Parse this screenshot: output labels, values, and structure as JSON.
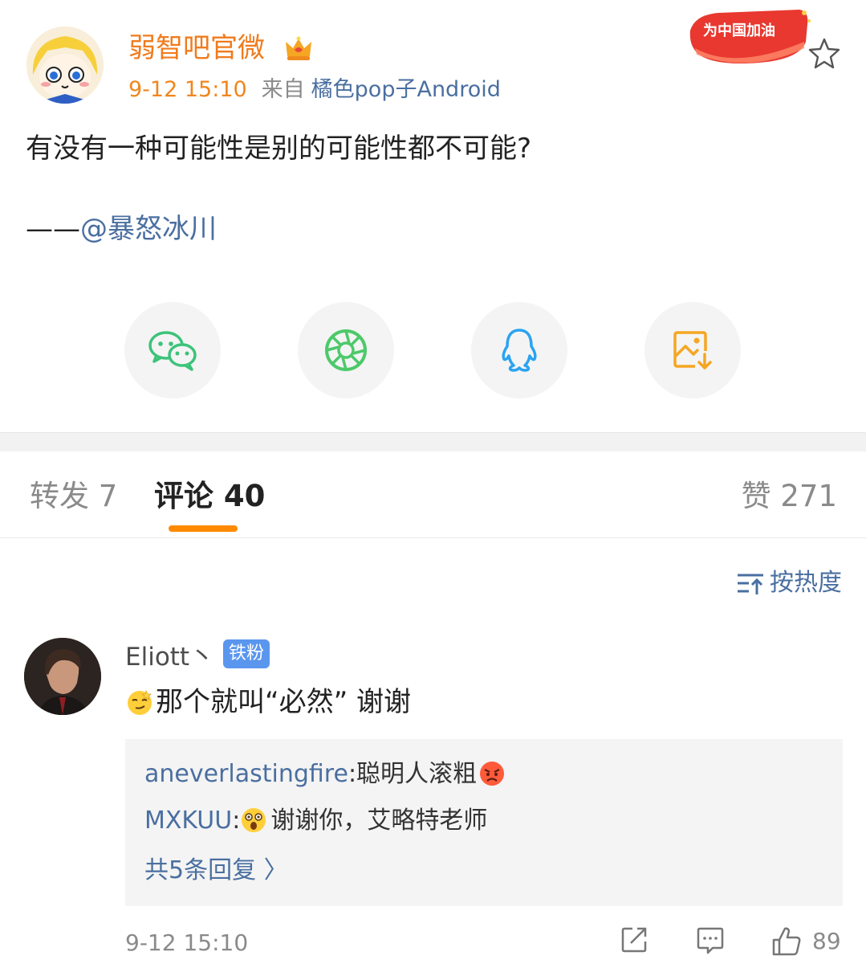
{
  "post": {
    "author": "弱智吧官微",
    "time": "9-12 15:10",
    "from_label": "来自",
    "source": "橘色pop子Android",
    "badge_text": "为中国加油",
    "body": "有没有一种可能性是别的可能性都不可能?",
    "sign_dash": "——",
    "sign_mention": "@暴怒冰川"
  },
  "share": {
    "items": [
      "wechat-icon",
      "moments-icon",
      "qq-icon",
      "save-image-icon"
    ],
    "colors": {
      "wechat": "#3cc37a",
      "moments": "#4dc96a",
      "qq": "#2aa3f2",
      "save": "#f5a623"
    }
  },
  "tabs": {
    "repost": "转发 7",
    "comment": "评论 40",
    "like": "赞 271"
  },
  "sort_label": "按热度",
  "comment": {
    "user": "Eliott丶",
    "badge": "铁粉",
    "text": "那个就叫“必然” 谢谢",
    "replies": [
      {
        "user": "aneverlastingfire",
        "sep": ": ",
        "text": "聪明人滚粗"
      },
      {
        "user": "MXKUU",
        "sep": ": ",
        "text": "谢谢你，艾略特老师"
      }
    ],
    "more_replies": "共5条回复 〉",
    "time": "9-12 15:10",
    "likes": "89"
  },
  "colors": {
    "accent": "#ff8a00",
    "link": "#4a6fa0",
    "author": "#f07b1d"
  }
}
